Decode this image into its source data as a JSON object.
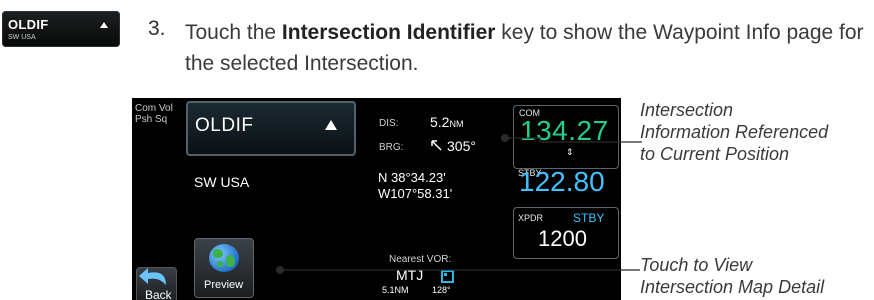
{
  "key_icon": {
    "ident": "OLDIF",
    "region": "SW USA"
  },
  "step": {
    "number": "3.",
    "pre": "Touch the ",
    "key_name": "Intersection Identifier",
    "post": " key to show the Waypoint Info page for the selected Intersection."
  },
  "screen": {
    "left_top_1": "Com Vol",
    "left_top_2": "Psh Sq",
    "back_label": "Back",
    "identifier": "OLDIF",
    "region": "SW USA",
    "preview_label": "Preview",
    "dis_label": "DIS:",
    "dis_value": "5.2",
    "dis_unit": "NM",
    "brg_label": "BRG:",
    "brg_value": "305°",
    "lat": "N 38°34.23'",
    "lon": "W107°58.31'",
    "nearest_label": "Nearest VOR:",
    "nearest_name": "MTJ",
    "nearest_dist": "5.1NM",
    "nearest_brg": "128°",
    "com_label": "COM",
    "com_active": "134.27",
    "stby_label": "STBY",
    "com_standby": "122.80",
    "xpdr_label": "XPDR",
    "xpdr_mode": "STBY",
    "squawk": "1200"
  },
  "callouts": {
    "info_line1": "Intersection",
    "info_line2": "Information Referenced",
    "info_line3": "to Current Position",
    "preview_line1": "Touch to View",
    "preview_line2": "Intersection Map Detail"
  },
  "colors": {
    "com_active": "#22d08c",
    "standby": "#43c0ff",
    "vor_symbol": "#28b8e8"
  }
}
